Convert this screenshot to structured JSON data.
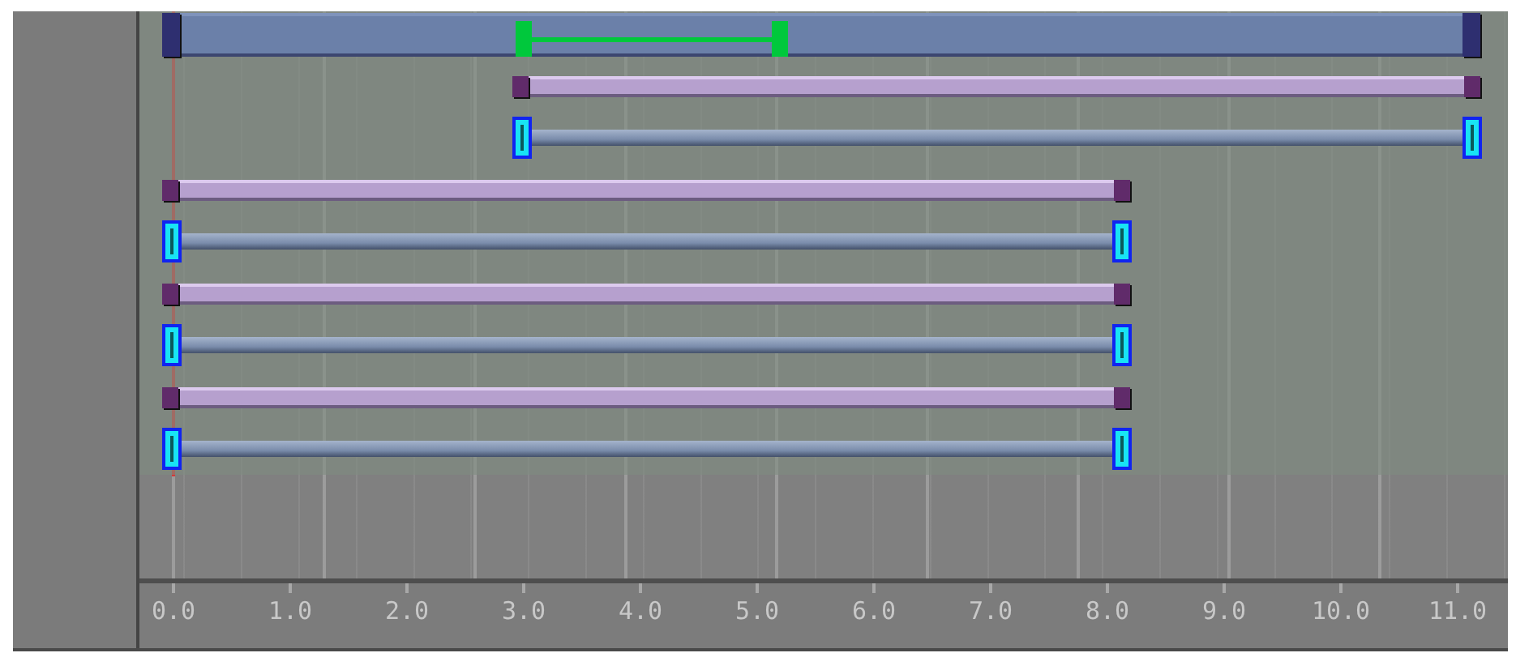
{
  "master": {
    "selection": {
      "kind": "range"
    }
  },
  "tracks": [
    {
      "kind": "clip"
    },
    {
      "kind": "range"
    },
    {
      "kind": "clip"
    },
    {
      "kind": "range"
    },
    {
      "kind": "clip"
    },
    {
      "kind": "range"
    },
    {
      "kind": "clip"
    },
    {
      "kind": "range"
    }
  ],
  "ruler": {
    "labels": [
      "0.0",
      "1.0",
      "2.0",
      "3.0",
      "4.0",
      "5.0",
      "6.0",
      "7.0",
      "8.0",
      "9.0",
      "10.0",
      "11.0"
    ]
  }
}
